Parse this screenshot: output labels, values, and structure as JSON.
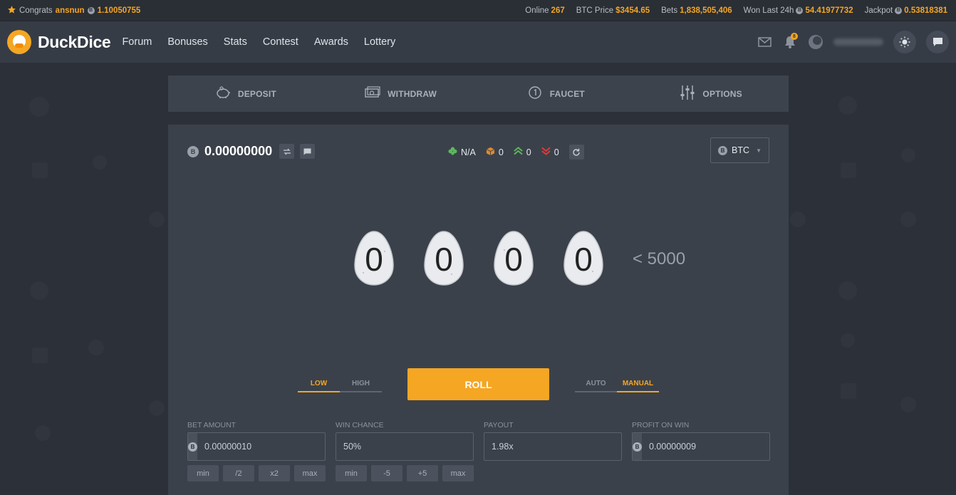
{
  "ticker": {
    "congrats_label": "Congrats",
    "congrats_user": "ansnun",
    "congrats_amount": "1.10050755",
    "online_label": "Online",
    "online_value": "267",
    "btc_price_label": "BTC Price",
    "btc_price_value": "$3454.65",
    "bets_label": "Bets",
    "bets_value": "1,838,505,406",
    "won_label": "Won Last 24h",
    "won_value": "54.41977732",
    "jackpot_label": "Jackpot",
    "jackpot_value": "0.53818381"
  },
  "nav": {
    "brand": "DuckDice",
    "links": [
      "Forum",
      "Bonuses",
      "Stats",
      "Contest",
      "Awards",
      "Lottery"
    ],
    "notification_count": "8"
  },
  "actions": {
    "deposit": "DEPOSIT",
    "withdraw": "WITHDRAW",
    "faucet": "FAUCET",
    "options": "OPTIONS"
  },
  "balance": {
    "amount": "0.00000000"
  },
  "stats": {
    "luck": "N/A",
    "bets": "0",
    "wins": "0",
    "losses": "0"
  },
  "currency": {
    "selected": "BTC"
  },
  "roll_result": {
    "digits": [
      "0",
      "0",
      "0",
      "0"
    ],
    "target": "< 5000"
  },
  "controls": {
    "low_label": "LOW",
    "high_label": "HIGH",
    "roll_label": "ROLL",
    "auto_label": "AUTO",
    "manual_label": "MANUAL"
  },
  "fields": {
    "bet_amount": {
      "label": "BET AMOUNT",
      "value": "0.00000010",
      "buttons": [
        "min",
        "/2",
        "x2",
        "max"
      ]
    },
    "win_chance": {
      "label": "WIN CHANCE",
      "value": "50%",
      "buttons": [
        "min",
        "-5",
        "+5",
        "max"
      ]
    },
    "payout": {
      "label": "PAYOUT",
      "value": "1.98x"
    },
    "profit_on_win": {
      "label": "PROFIT ON WIN",
      "value": "0.00000009"
    }
  },
  "colors": {
    "accent": "#f5a623",
    "background": "#2b3039",
    "panel": "#3b414b",
    "nav": "#363c46"
  }
}
